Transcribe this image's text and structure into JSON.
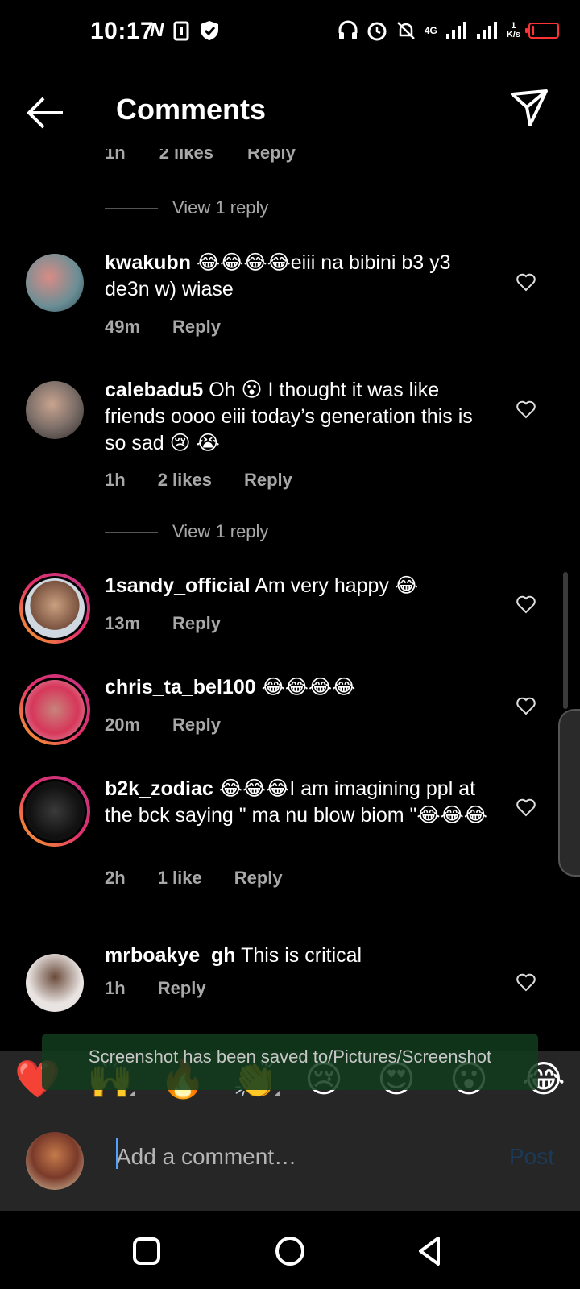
{
  "status": {
    "time": "10:17",
    "network": "4G",
    "speed_value": "1",
    "speed_unit": "K/s",
    "battery_level": 0.1
  },
  "header": {
    "title": "Comments"
  },
  "partial": {
    "time": "1h",
    "likes": "2 likes",
    "reply": "Reply"
  },
  "replies_link": "View 1 reply",
  "comments": [
    {
      "user": "kwakubn",
      "text": "😂😂😂😂eiii na bibini b3 y3 de3n w) wiase",
      "time": "49m",
      "likes": "",
      "reply": "Reply"
    },
    {
      "user": "calebadu5",
      "text": "Oh 😮 I thought it was like friends oooo eiii today’s generation  this is so sad 😢 😭",
      "time": "1h",
      "likes": "2 likes",
      "reply": "Reply"
    },
    {
      "user": "1sandy_official",
      "text": "Am very happy 😂",
      "time": "13m",
      "likes": "",
      "reply": "Reply"
    },
    {
      "user": "chris_ta_bel100",
      "text": "😂😂😂😂",
      "time": "20m",
      "likes": "",
      "reply": "Reply"
    },
    {
      "user": "b2k_zodiac",
      "text": "😂😂😂I am imagining ppl at the bck saying \" ma nu blow biom \"😂😂😂",
      "time": "2h",
      "likes": "1 like",
      "reply": "Reply"
    },
    {
      "user": "mrboakye_gh",
      "text": "This is critical",
      "time": "1h",
      "likes": "",
      "reply": "Reply"
    }
  ],
  "toast": "Screenshot has been saved to/Pictures/Screenshot",
  "emoji_bar": [
    "❤️",
    "🙌",
    "🔥",
    "👏",
    "😢",
    "😍",
    "😮",
    "😂"
  ],
  "composer": {
    "placeholder": "Add a comment…",
    "post_label": "Post"
  },
  "colors": {
    "background": "#000000",
    "secondary_text": "#a8a8a8",
    "post_disabled": "#1b3a5a"
  }
}
